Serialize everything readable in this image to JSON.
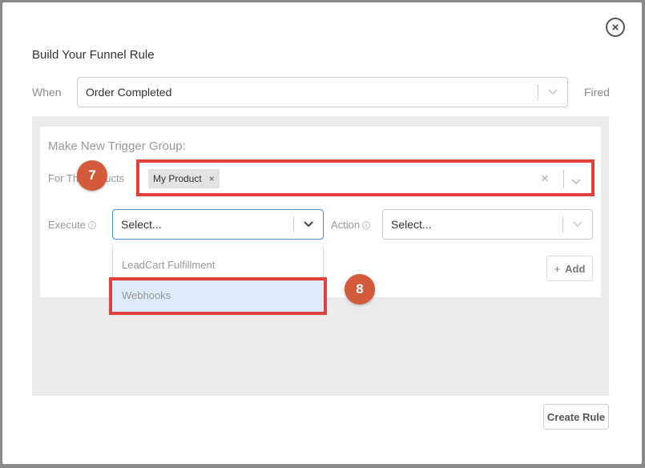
{
  "modal": {
    "title": "Build Your Funnel Rule",
    "close_icon": "close-icon",
    "when_label": "When",
    "event_select_value": "Order Completed",
    "fired_label": "Fired",
    "create_rule_label": "Create Rule"
  },
  "trigger_group": {
    "title": "Make New Trigger Group:",
    "products_label": "For Th",
    "products_label_tail": "ducts",
    "product_tag": "My Product",
    "tag_remove": "×",
    "clear_all": "×",
    "execute_label": "Execute",
    "execute_placeholder": "Select...",
    "action_label": "Action",
    "action_placeholder": "Select...",
    "dropdown_options": [
      "LeadCart Fulfillment",
      "Webhooks"
    ],
    "add_label": "Add",
    "add_plus": "+"
  },
  "annotations": {
    "step_7": "7",
    "step_8": "8",
    "highlight_color": "#e0413b",
    "badge_color": "#d35b3c"
  }
}
